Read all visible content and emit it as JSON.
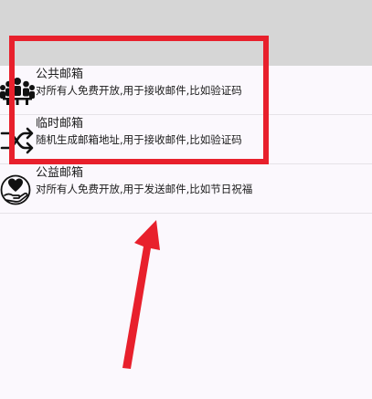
{
  "colors": {
    "top_bar": "#d6d6d6",
    "background": "#fbf8fd",
    "annotation": "#e8202c"
  },
  "mail_types": [
    {
      "title": "公共邮箱",
      "description": "对所有人免费开放,用于接收邮件,比如验证码",
      "icon": "group-people-icon"
    },
    {
      "title": "临时邮箱",
      "description": "随机生成邮箱地址,用于接收邮件,比如验证码",
      "icon": "shuffle-icon"
    },
    {
      "title": "公益邮箱",
      "description": "对所有人免费开放,用于发送邮件,比如节日祝福",
      "icon": "heart-hand-icon"
    }
  ]
}
